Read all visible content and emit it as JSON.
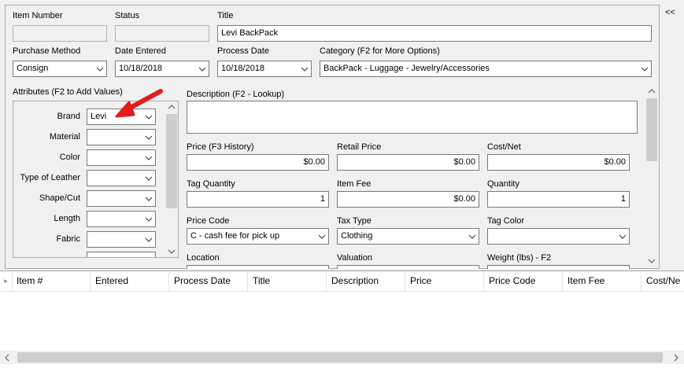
{
  "collapse_button": "<<",
  "top": {
    "item_number_label": "Item Number",
    "item_number_value": "",
    "status_label": "Status",
    "status_value": "",
    "title_label": "Title",
    "title_value": "Levi BackPack",
    "purchase_method_label": "Purchase Method",
    "purchase_method_value": "Consign",
    "date_entered_label": "Date Entered",
    "date_entered_value": "10/18/2018",
    "process_date_label": "Process Date",
    "process_date_value": "10/18/2018",
    "category_label": "Category (F2 for More Options)",
    "category_value": "BackPack - Luggage - Jewelry/Accessories"
  },
  "attributes": {
    "label": "Attributes (F2 to Add Values)",
    "rows": [
      {
        "name": "Brand",
        "value": "Levi"
      },
      {
        "name": "Material",
        "value": ""
      },
      {
        "name": "Color",
        "value": ""
      },
      {
        "name": "Type of Leather",
        "value": ""
      },
      {
        "name": "Shape/Cut",
        "value": ""
      },
      {
        "name": "Length",
        "value": ""
      },
      {
        "name": "Fabric",
        "value": ""
      }
    ]
  },
  "details": {
    "description_label": "Description (F2 - Lookup)",
    "description_value": "",
    "price_label": "Price (F3 History)",
    "price_value": "$0.00",
    "retail_price_label": "Retail Price",
    "retail_price_value": "$0.00",
    "cost_net_label": "Cost/Net",
    "cost_net_value": "$0.00",
    "tag_quantity_label": "Tag Quantity",
    "tag_quantity_value": "1",
    "item_fee_label": "Item Fee",
    "item_fee_value": "$0.00",
    "quantity_label": "Quantity",
    "quantity_value": "1",
    "price_code_label": "Price Code",
    "price_code_value": "C - cash fee for pick up",
    "tax_type_label": "Tax Type",
    "tax_type_value": "Clothing",
    "tag_color_label": "Tag Color",
    "tag_color_value": "",
    "location_label": "Location",
    "valuation_label": "Valuation",
    "weight_label": "Weight (lbs) - F2"
  },
  "grid": {
    "columns": [
      "Item #",
      "Entered",
      "Process Date",
      "Title",
      "Description",
      "Price",
      "Price Code",
      "Item Fee",
      "Cost/Ne"
    ]
  },
  "colors": {
    "arrow": "#e31b1b",
    "focus_border": "#3c7fb1"
  }
}
